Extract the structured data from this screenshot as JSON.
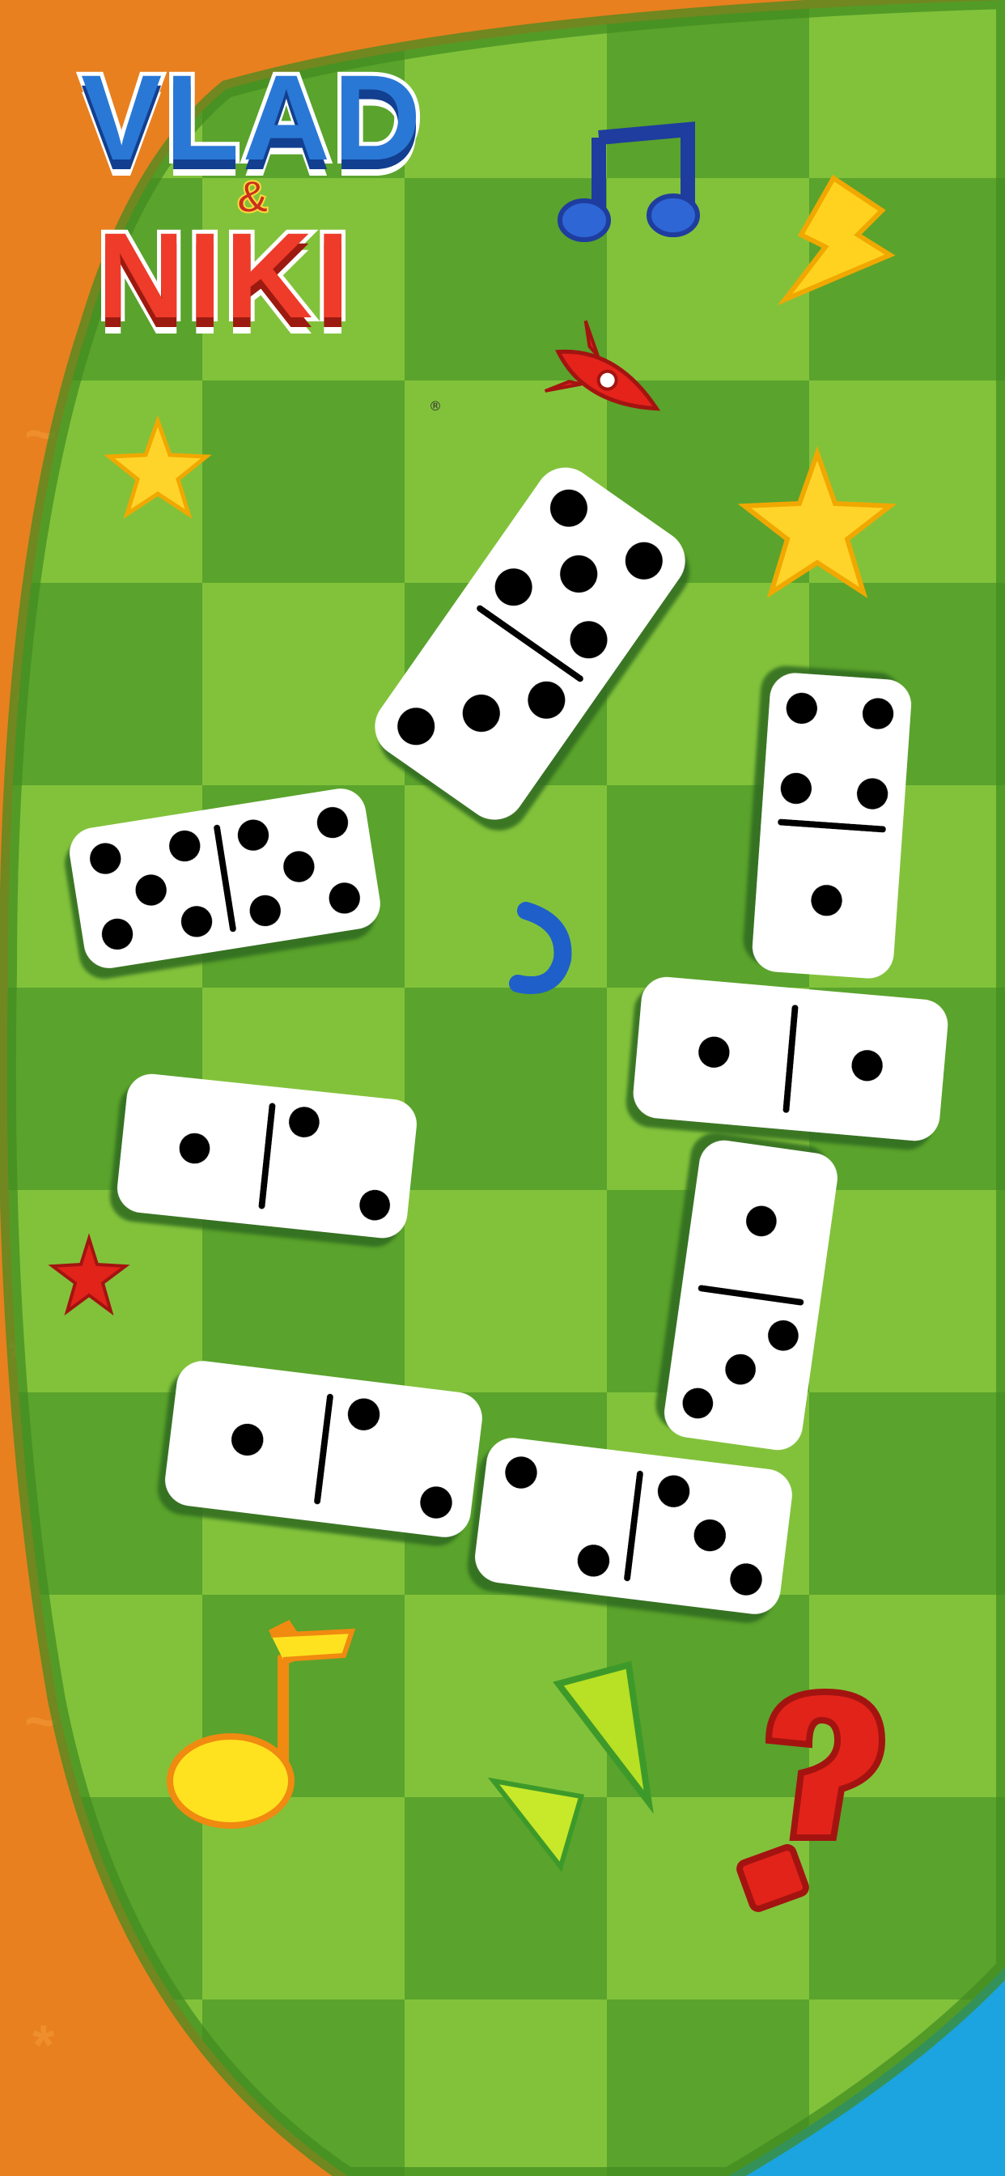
{
  "app": {
    "logo_top": "VLAD",
    "logo_amp": "&",
    "logo_bottom": "NIKI",
    "logo_mark": "®"
  },
  "colors": {
    "board_light": "#8cc63f",
    "board_dark": "#5aa32c",
    "frame_orange": "#e8801f",
    "corner_blue": "#1ba4e0",
    "domino_face": "#ffffff",
    "pip": "#000000"
  },
  "dominoes": [
    {
      "id": "d1",
      "ends": [
        3,
        5
      ]
    },
    {
      "id": "d2",
      "ends": [
        5,
        5
      ]
    },
    {
      "id": "d3",
      "ends": [
        4,
        1
      ]
    },
    {
      "id": "d4",
      "ends": [
        1,
        1
      ]
    },
    {
      "id": "d5",
      "ends": [
        1,
        2
      ]
    },
    {
      "id": "d6",
      "ends": [
        1,
        3
      ]
    },
    {
      "id": "d7",
      "ends": [
        1,
        2
      ]
    },
    {
      "id": "d8",
      "ends": [
        2,
        3
      ]
    }
  ],
  "decorations": [
    "double-music-note-icon",
    "lightning-icon",
    "rocket-icon",
    "star-icon",
    "star-icon",
    "star-icon",
    "hook-shape-icon",
    "music-note-icon",
    "triangle-icon",
    "triangle-icon",
    "question-mark-icon"
  ]
}
